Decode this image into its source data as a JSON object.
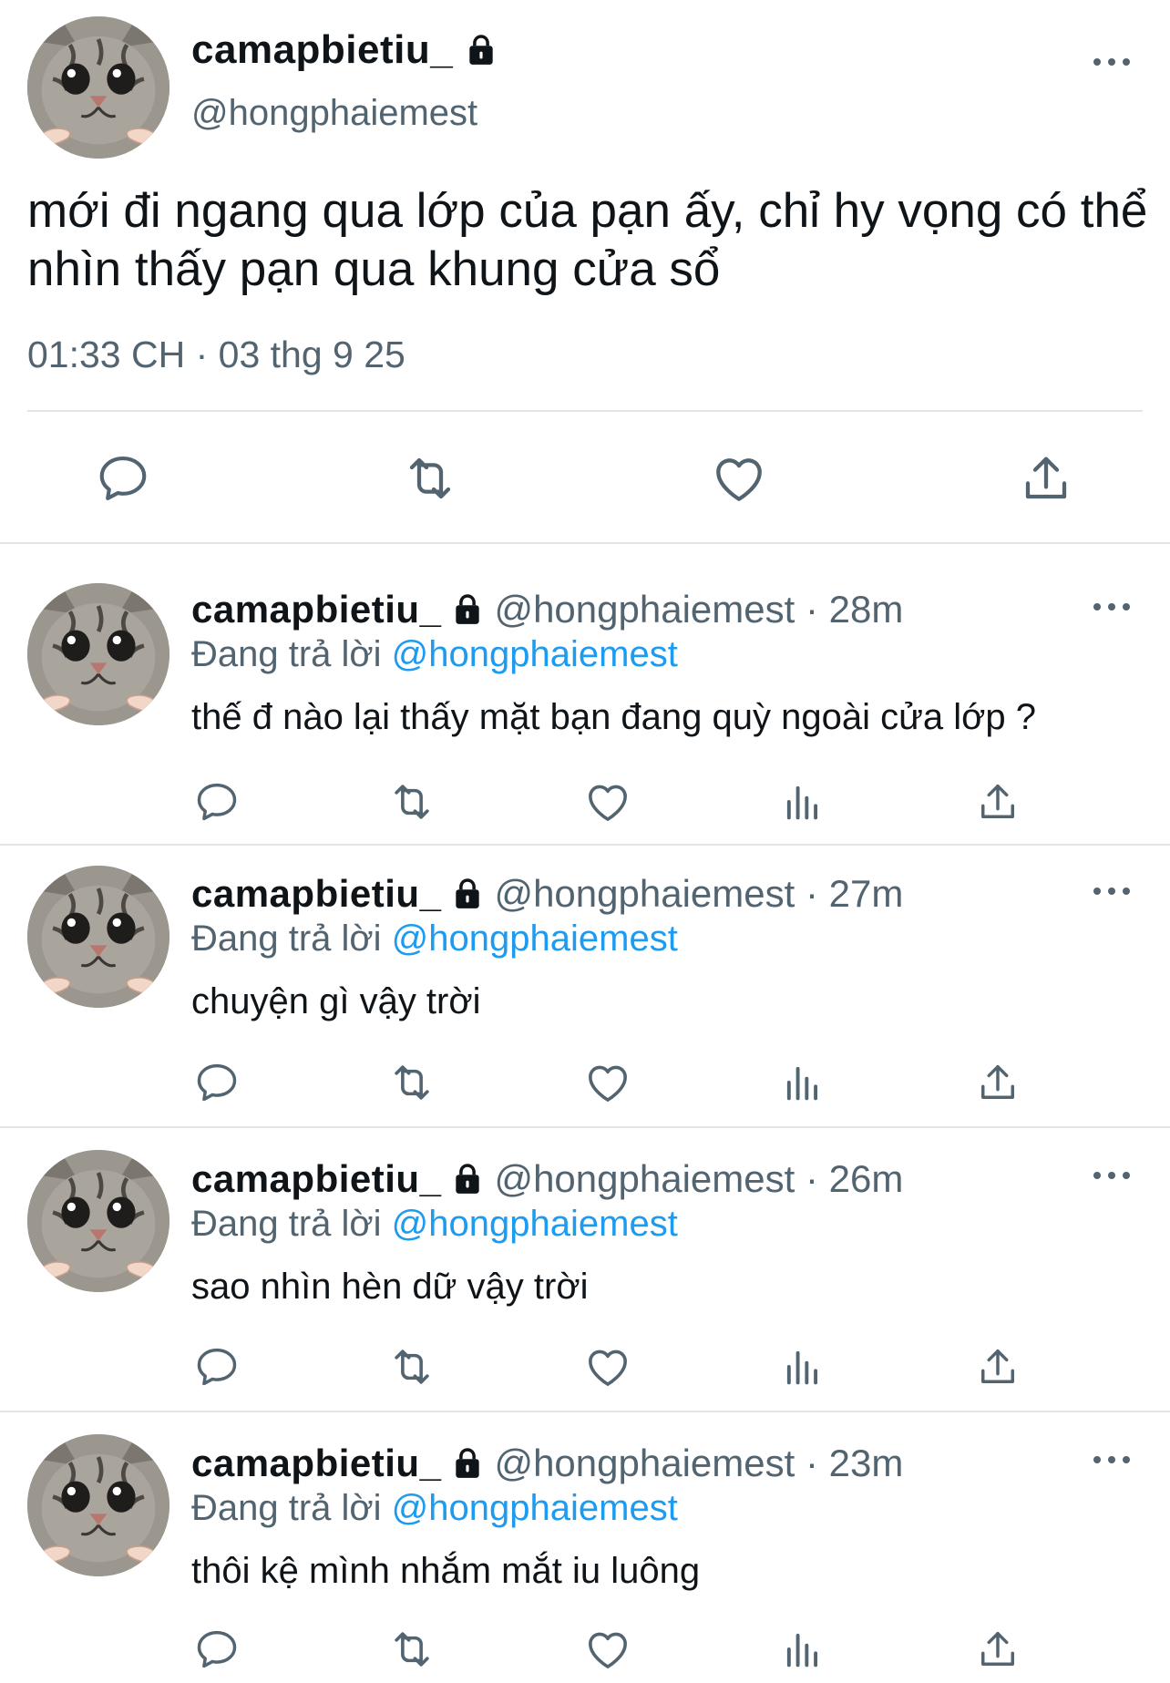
{
  "main_tweet": {
    "display_name": "camapbietiu_",
    "handle": "@hongphaiemest",
    "text": "mới đi ngang qua lớp của pạn ấy, chỉ hy vọng có thể nhìn thấy pạn qua khung cửa sổ",
    "timestamp": "01:33 CH · 03 thg 9 25",
    "actions": [
      "reply-icon",
      "retweet-icon",
      "like-icon",
      "share-icon"
    ]
  },
  "replies": [
    {
      "display_name": "camapbietiu_",
      "handle_time": "@hongphaiemest · 28m",
      "replying_prefix": "Đang trả lời",
      "replying_to": "@hongphaiemest",
      "text": "thế đ nào lại thấy mặt bạn đang quỳ ngoài cửa lớp ?"
    },
    {
      "display_name": "camapbietiu_",
      "handle_time": "@hongphaiemest · 27m",
      "replying_prefix": "Đang trả lời",
      "replying_to": "@hongphaiemest",
      "text": "chuyện gì vậy trời"
    },
    {
      "display_name": "camapbietiu_",
      "handle_time": "@hongphaiemest · 26m",
      "replying_prefix": "Đang trả lời",
      "replying_to": "@hongphaiemest",
      "text": "sao nhìn hèn dữ vậy trời"
    },
    {
      "display_name": "camapbietiu_",
      "handle_time": "@hongphaiemest · 23m",
      "replying_prefix": "Đang trả lời",
      "replying_to": "@hongphaiemest",
      "text": "thôi kệ mình nhắm mắt iu luông"
    }
  ],
  "colors": {
    "text": "#0f1419",
    "secondary": "#536471",
    "link": "#1d9bf0",
    "divider": "#e1e4e8"
  }
}
